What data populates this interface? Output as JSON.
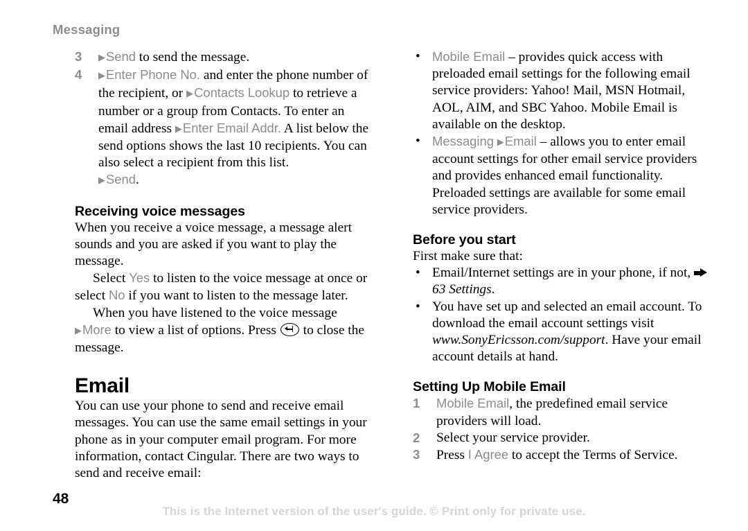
{
  "page": {
    "running_head": "Messaging",
    "page_number": "48",
    "footer_note": "This is the Internet version of the user's guide. © Print only for private use."
  },
  "left_column": {
    "steps": [
      {
        "number": "3",
        "segments": [
          {
            "type": "triangle"
          },
          {
            "type": "ui",
            "text": "Send"
          },
          {
            "type": "text",
            "text": " to send the message."
          }
        ]
      },
      {
        "number": "4",
        "segments": [
          {
            "type": "triangle"
          },
          {
            "type": "ui",
            "text": "Enter Phone No."
          },
          {
            "type": "text",
            "text": " and enter the phone number of the recipient, or "
          },
          {
            "type": "triangle"
          },
          {
            "type": "ui",
            "text": "Contacts Lookup"
          },
          {
            "type": "text",
            "text": " to retrieve a number or a group from Contacts. To enter an email address "
          },
          {
            "type": "triangle"
          },
          {
            "type": "ui",
            "text": "Enter Email Addr."
          },
          {
            "type": "text",
            "text": " A list below the send options shows the last 10 recipients. You can also select a recipient from this list."
          }
        ],
        "trailing": [
          {
            "type": "triangle"
          },
          {
            "type": "ui",
            "text": "Send"
          },
          {
            "type": "text",
            "text": "."
          }
        ]
      }
    ],
    "receiving_voice_messages": {
      "heading": "Receiving voice messages",
      "para1": "When you receive a voice message, a message alert sounds and you are asked if you want to play the message.",
      "para2": [
        {
          "type": "text",
          "text": "Select "
        },
        {
          "type": "ui",
          "text": "Yes"
        },
        {
          "type": "text",
          "text": " to listen to the voice message at once or select "
        },
        {
          "type": "ui",
          "text": "No"
        },
        {
          "type": "text",
          "text": " if you want to listen to the message later."
        }
      ],
      "para3": [
        {
          "type": "text",
          "text": "When you have listened to the voice message "
        },
        {
          "type": "triangle"
        },
        {
          "type": "ui",
          "text": "More"
        },
        {
          "type": "text",
          "text": " to view a list of options. Press "
        },
        {
          "type": "key-back"
        },
        {
          "type": "text",
          "text": " to close the message."
        }
      ]
    },
    "email": {
      "heading": "Email",
      "para": "You can use your phone to send and receive email messages. You can use the same email settings in your phone as in your computer email program. For more information, contact Cingular. There are two ways to send and receive email:"
    }
  },
  "right_column": {
    "options": [
      {
        "segments": [
          {
            "type": "ui",
            "text": "Mobile Email"
          },
          {
            "type": "text",
            "text": " – provides quick access with preloaded email settings for the following email service providers: Yahoo! Mail, MSN Hotmail, AOL, AIM, and SBC Yahoo. Mobile Email is available on the desktop."
          }
        ]
      },
      {
        "segments": [
          {
            "type": "ui",
            "text": "Messaging"
          },
          {
            "type": "text",
            "text": " "
          },
          {
            "type": "triangle"
          },
          {
            "type": "ui",
            "text": "Email"
          },
          {
            "type": "text",
            "text": " – allows you to enter email account settings for other email service providers and provides enhanced email functionality. Preloaded settings are available for some email service providers."
          }
        ]
      }
    ],
    "before_you_start": {
      "heading": "Before you start",
      "intro": "First make sure that:",
      "items": [
        {
          "segments": [
            {
              "type": "text",
              "text": "Email/Internet settings are in your phone, if not, "
            },
            {
              "type": "xref-arrow"
            },
            {
              "type": "italic",
              "text": "63 Settings"
            },
            {
              "type": "text",
              "text": "."
            }
          ]
        },
        {
          "segments": [
            {
              "type": "text",
              "text": "You have set up and selected an email account. To download the email account settings visit "
            },
            {
              "type": "italic",
              "text": "www.SonyEricsson.com/support"
            },
            {
              "type": "text",
              "text": ". Have your email account details at hand."
            }
          ]
        }
      ]
    },
    "setting_up_mobile_email": {
      "heading": "Setting Up Mobile Email",
      "steps": [
        {
          "number": "1",
          "segments": [
            {
              "type": "ui",
              "text": "Mobile Email"
            },
            {
              "type": "text",
              "text": ", the predefined email service providers will load."
            }
          ]
        },
        {
          "number": "2",
          "segments": [
            {
              "type": "text",
              "text": "Select your service provider."
            }
          ]
        },
        {
          "number": "3",
          "segments": [
            {
              "type": "text",
              "text": "Press "
            },
            {
              "type": "ui",
              "text": "I Agree"
            },
            {
              "type": "text",
              "text": " to accept the Terms of Service."
            }
          ]
        }
      ]
    }
  }
}
